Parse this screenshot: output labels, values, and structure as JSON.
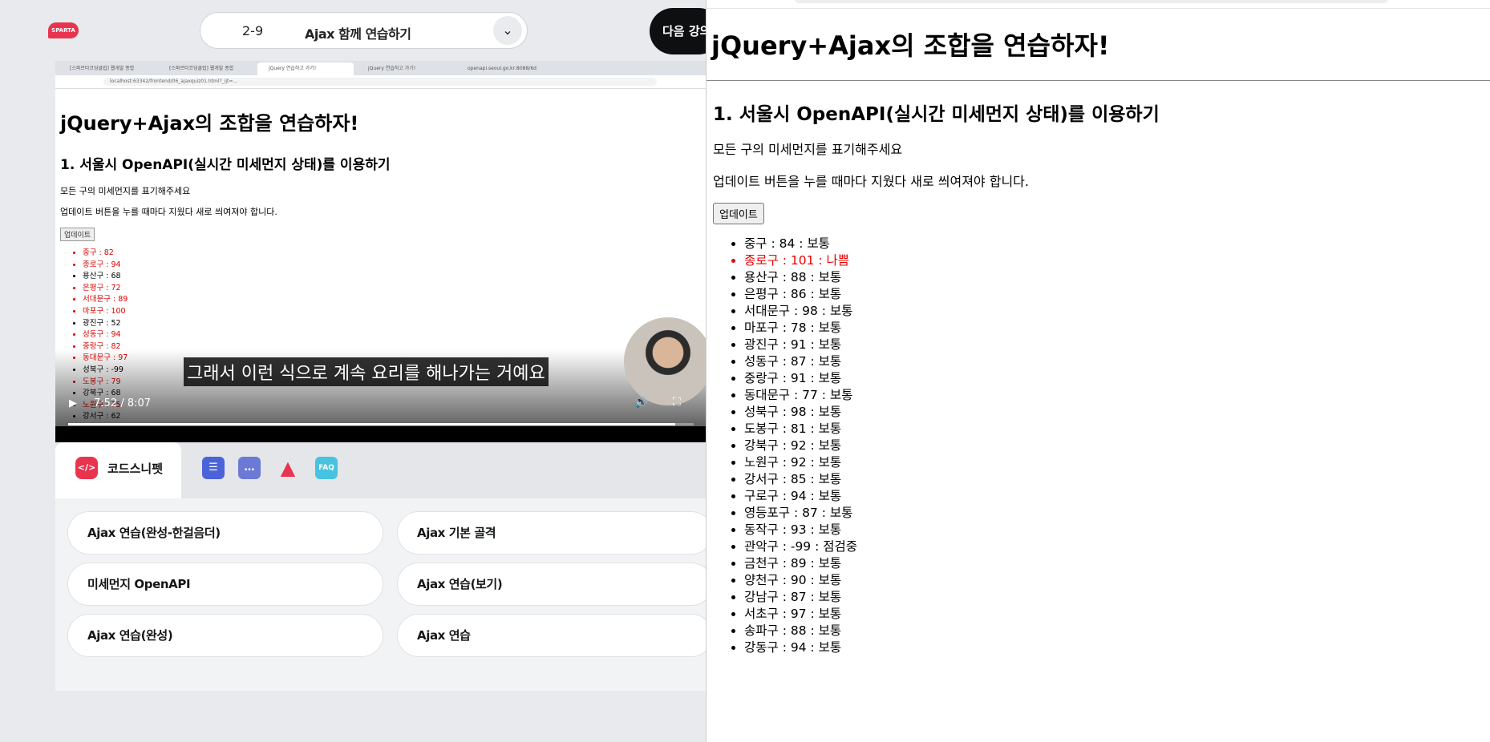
{
  "header": {
    "logo_text": "SPARTA",
    "lesson_number": "2-9",
    "lesson_title": "Ajax 함께 연습하기",
    "next_label": "다음 강의"
  },
  "video": {
    "tabs": [
      "[스파르타코딩클럽] 웹개발 종합",
      "[스파르타코딩클럽] 웹개발 종합",
      "jQuery 연습하고 가기!",
      "jQuery 연습하고 가기!",
      "openapi.seoul.go.kr:8088/6d"
    ],
    "url": "localhost:63342/frontend/06_ajaxquiz01.html?_ijt=...",
    "h1": "jQuery+Ajax의 조합을 연습하자!",
    "h2": "1. 서울시 OpenAPI(실시간 미세먼지 상태)를 이용하기",
    "p1": "모든 구의 미세먼지를 표기해주세요",
    "p2": "업데이트 버튼을 누를 때마다 지웠다 새로 씌여져야 합니다.",
    "button": "업데이트",
    "items": [
      {
        "text": "중구 : 82",
        "red": true
      },
      {
        "text": "종로구 : 94",
        "red": true
      },
      {
        "text": "용산구 : 68",
        "red": false
      },
      {
        "text": "은평구 : 72",
        "red": true
      },
      {
        "text": "서대문구 : 89",
        "red": true
      },
      {
        "text": "마포구 : 100",
        "red": true
      },
      {
        "text": "광진구 : 52",
        "red": false
      },
      {
        "text": "성동구 : 94",
        "red": true
      },
      {
        "text": "중랑구 : 82",
        "red": true
      },
      {
        "text": "동대문구 : 97",
        "red": true
      },
      {
        "text": "성북구 : -99",
        "red": false
      },
      {
        "text": "도봉구 : 79",
        "red": true
      },
      {
        "text": "강북구 : 68",
        "red": false
      },
      {
        "text": "노원구 : 75",
        "red": true
      },
      {
        "text": "강서구 : 62",
        "red": false
      }
    ],
    "subtitle": "그래서 이런 식으로 계속 요리를 해나가는 거예요",
    "time": "7:52 / 8:07",
    "progress": 0.97
  },
  "tools": {
    "snippet_label": "코드스니펫",
    "faq_label": "FAQ",
    "cards": [
      "Ajax 연습(완성-한걸음더)",
      "Ajax 기본 골격",
      "미세먼지 OpenAPI",
      "Ajax 연습(보기)",
      "Ajax 연습(완성)",
      "Ajax 연습"
    ]
  },
  "page": {
    "h1": "jQuery+Ajax의 조합을 연습하자!",
    "h2": "1. 서울시 OpenAPI(실시간 미세먼지 상태)를 이용하기",
    "p1": "모든 구의 미세먼지를 표기해주세요",
    "p2": "업데이트 버튼을 누를 때마다 지웠다 새로 씌여져야 합니다.",
    "button": "업데이트",
    "items": [
      {
        "text": "중구 : 84 : 보통",
        "red": false
      },
      {
        "text": "종로구 : 101 : 나쁨",
        "red": true
      },
      {
        "text": "용산구 : 88 : 보통",
        "red": false
      },
      {
        "text": "은평구 : 86 : 보통",
        "red": false
      },
      {
        "text": "서대문구 : 98 : 보통",
        "red": false
      },
      {
        "text": "마포구 : 78 : 보통",
        "red": false
      },
      {
        "text": "광진구 : 91 : 보통",
        "red": false
      },
      {
        "text": "성동구 : 87 : 보통",
        "red": false
      },
      {
        "text": "중랑구 : 91 : 보통",
        "red": false
      },
      {
        "text": "동대문구 : 77 : 보통",
        "red": false
      },
      {
        "text": "성북구 : 98 : 보통",
        "red": false
      },
      {
        "text": "도봉구 : 81 : 보통",
        "red": false
      },
      {
        "text": "강북구 : 92 : 보통",
        "red": false
      },
      {
        "text": "노원구 : 92 : 보통",
        "red": false
      },
      {
        "text": "강서구 : 85 : 보통",
        "red": false
      },
      {
        "text": "구로구 : 94 : 보통",
        "red": false
      },
      {
        "text": "영등포구 : 87 : 보통",
        "red": false
      },
      {
        "text": "동작구 : 93 : 보통",
        "red": false
      },
      {
        "text": "관악구 : -99 : 점검중",
        "red": false
      },
      {
        "text": "금천구 : 89 : 보통",
        "red": false
      },
      {
        "text": "양천구 : 90 : 보통",
        "red": false
      },
      {
        "text": "강남구 : 87 : 보통",
        "red": false
      },
      {
        "text": "서초구 : 97 : 보통",
        "red": false
      },
      {
        "text": "송파구 : 88 : 보통",
        "red": false
      },
      {
        "text": "강동구 : 94 : 보통",
        "red": false
      }
    ]
  },
  "colors": {
    "brand": "#e8344e",
    "warning": "#e00000",
    "next_button": "#0e0f10"
  },
  "icons": {
    "snippet": "code-icon",
    "notes": "checklist-icon",
    "chat": "chat-bubble-icon",
    "alert": "warning-triangle-icon",
    "faq": "faq-icon"
  }
}
